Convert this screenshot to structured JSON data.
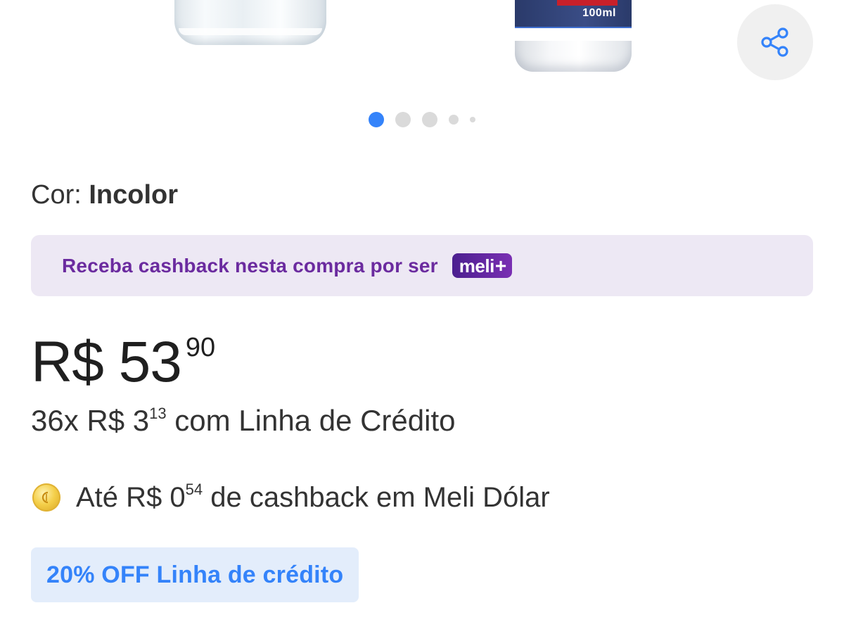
{
  "gallery": {
    "left_product_image": "product-bottle-clear",
    "right_product_image": "product-bottle-white",
    "right_bottle_volume": "100ml",
    "share_icon": "share-icon",
    "dots_total": 5,
    "dots_active_index": 0
  },
  "variant": {
    "label": "Cor:",
    "value": "Incolor"
  },
  "meli_banner": {
    "text": "Receba cashback nesta compra por ser",
    "badge_word": "meli",
    "badge_plus": "+"
  },
  "price": {
    "currency": "R$",
    "integer": "53",
    "cents": "90",
    "display_main": "R$ 53"
  },
  "installments": {
    "prefix": "36x R$ 3",
    "cents": "13",
    "suffix": " com Linha de Crédito"
  },
  "cashback": {
    "icon": "coin-icon",
    "prefix": "Até R$ 0",
    "cents": "54",
    "suffix": " de cashback em Meli Dólar"
  },
  "discount_tag": {
    "text": "20% OFF Linha de crédito"
  },
  "colors": {
    "accent_blue": "#3483fa",
    "meli_purple": "#6b2b9f",
    "banner_bg": "#ede8f4",
    "tag_bg": "#e3edfb"
  }
}
